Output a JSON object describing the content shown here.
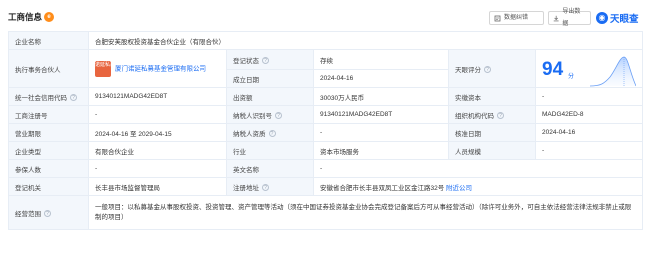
{
  "header": {
    "title": "工商信息",
    "title_badge": "e",
    "error_button": "数据纠错",
    "export_button": "导出数据",
    "logo_text": "天眼查"
  },
  "company": {
    "name_label": "企业名称",
    "name": "合肥安芙股权投资基金合伙企业（有限合伙）",
    "partner_label": "执行事务合伙人",
    "partner_avatar": "诺延私募",
    "partner_name": "厦门诺延私募基金管理有限公司",
    "status_label": "登记状态",
    "status": "存续",
    "founded_label": "成立日期",
    "founded": "2024-04-16",
    "rating_label": "天眼评分",
    "rating_score": "94",
    "rating_unit": "分",
    "credit_code_label": "统一社会信用代码",
    "credit_code": "91340121MADG42ED8T",
    "capital_label": "出资额",
    "capital": "30030万人民币",
    "paid_capital_label": "实缴资本",
    "paid_capital": "-",
    "reg_no_label": "工商注册号",
    "reg_no": "-",
    "taxpayer_id_label": "纳税人识别号",
    "taxpayer_id": "91340121MADG42ED8T",
    "org_code_label": "组织机构代码",
    "org_code": "MADG42ED-8",
    "term_label": "营业期限",
    "term": "2024-04-16 至 2029-04-15",
    "taxpayer_qual_label": "纳税人资质",
    "taxpayer_qual": "-",
    "approval_date_label": "核准日期",
    "approval_date": "2024-04-16",
    "type_label": "企业类型",
    "type": "有限合伙企业",
    "industry_label": "行业",
    "industry": "资本市场服务",
    "staff_label": "人员规模",
    "staff": "-",
    "insured_label": "参保人数",
    "insured": "-",
    "english_name_label": "英文名称",
    "english_name": "-",
    "authority_label": "登记机关",
    "authority": "长丰县市场监督管理局",
    "address_label": "注册地址",
    "address": "安徽省合肥市长丰县双凤工业区金江路32号",
    "nearby_link": "附近公司",
    "scope_label": "经营范围",
    "scope": "一般项目：以私募基金从事股权投资、投资管理、资产管理等活动（须在中国证券投资基金业协会完成登记备案后方可从事经营活动）（除许可业务外，可自主依法经营法律法规非禁止或限制的项目）"
  },
  "colors": {
    "accent": "#1a6cf3",
    "status": "#12a05c",
    "label_bg": "#f3f7fc",
    "border": "#e7edf5"
  }
}
